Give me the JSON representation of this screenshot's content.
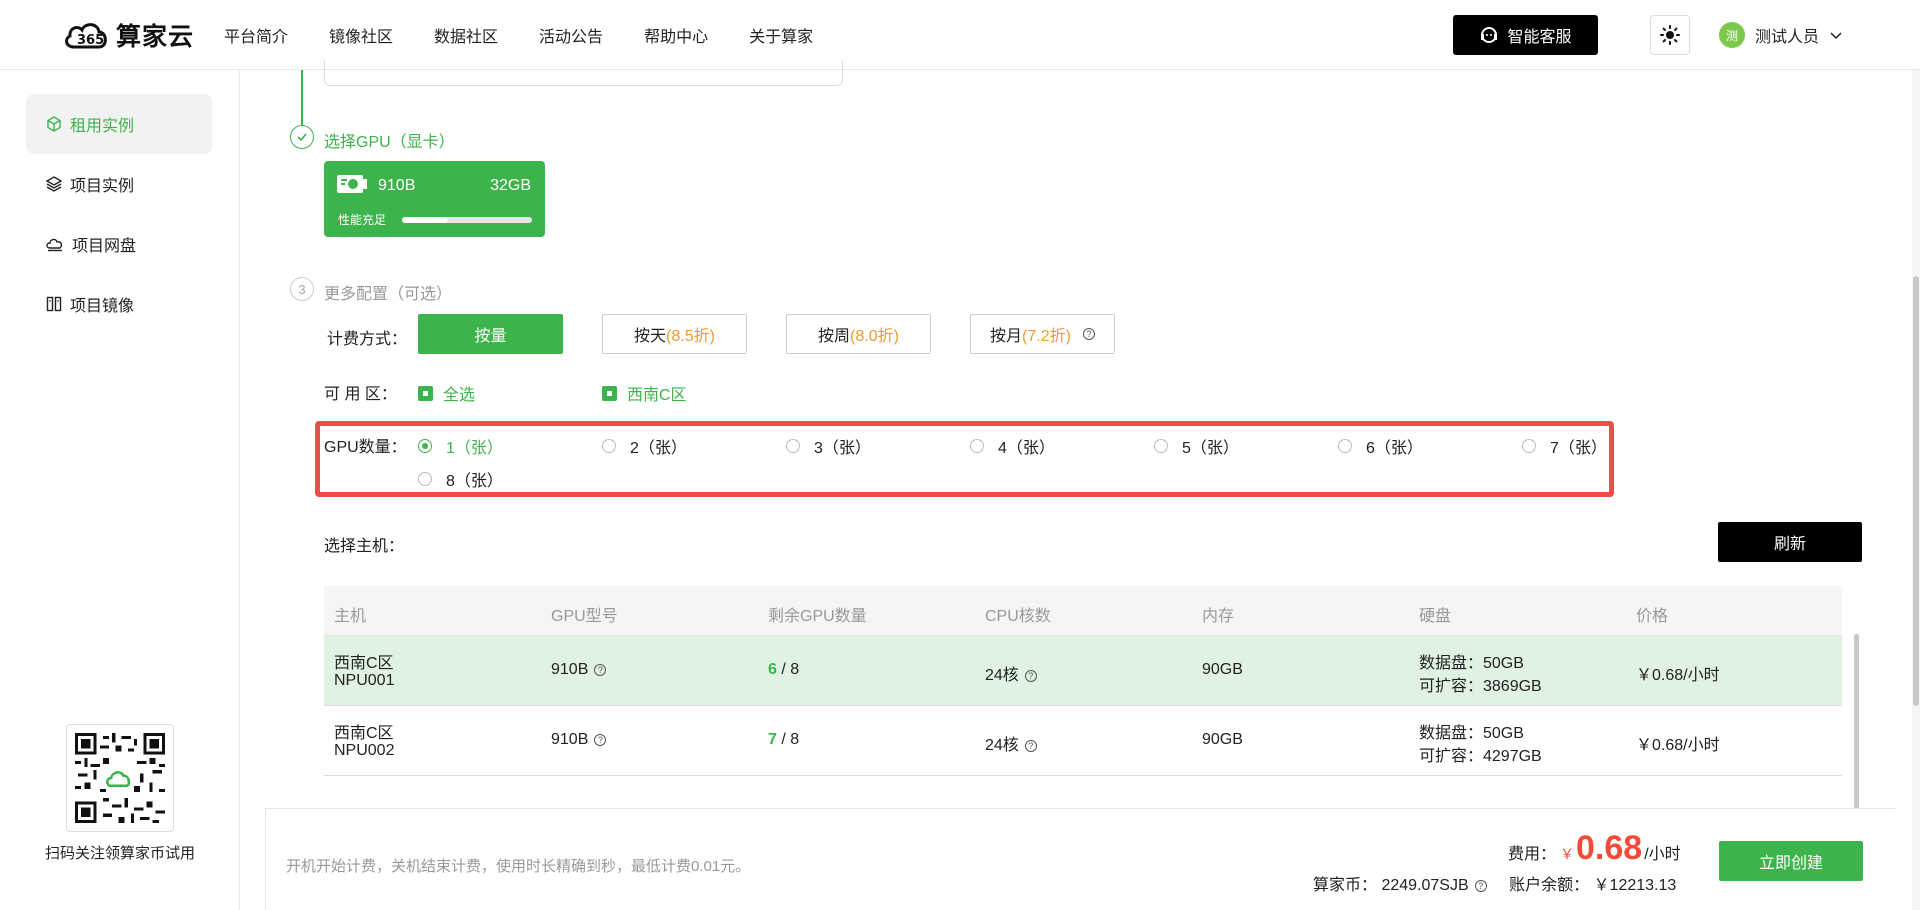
{
  "header": {
    "logo_text": "算家云",
    "nav": [
      "平台简介",
      "镜像社区",
      "数据社区",
      "活动公告",
      "帮助中心",
      "关于算家"
    ],
    "service_label": "智能客服",
    "user_avatar": "测",
    "user_name": "测试人员"
  },
  "sidebar": {
    "items": [
      {
        "label": "租用实例",
        "icon": "cube-icon",
        "active": true
      },
      {
        "label": "项目实例",
        "icon": "layers-icon",
        "active": false
      },
      {
        "label": "项目网盘",
        "icon": "cloud-disk-icon",
        "active": false
      },
      {
        "label": "项目镜像",
        "icon": "image-icon",
        "active": false
      }
    ],
    "qr_caption": "扫码关注领算家币试用"
  },
  "steps": {
    "gpu_title": "选择GPU（显卡）",
    "more_number": "3",
    "more_title": "更多配置（可选）"
  },
  "gpu_card": {
    "name": "910B",
    "memory": "32GB",
    "perf_label": "性能充足",
    "perf_level": 0.35
  },
  "billing": {
    "label": "计费方式：",
    "options": [
      {
        "label": "按量",
        "discount": ""
      },
      {
        "label": "按天",
        "discount": "(8.5折)"
      },
      {
        "label": "按周",
        "discount": "(8.0折)"
      },
      {
        "label": "按月",
        "discount": "(7.2折)"
      }
    ]
  },
  "zone": {
    "label": "可 用 区：",
    "select_all": "全选",
    "region": "西南C区"
  },
  "gpu_count": {
    "label": "GPU数量：",
    "options": [
      "1（张）",
      "2（张）",
      "3（张）",
      "4（张）",
      "5（张）",
      "6（张）",
      "7（张）",
      "8（张）"
    ],
    "selected": 0
  },
  "host": {
    "label": "选择主机：",
    "refresh": "刷新",
    "columns": [
      "主机",
      "GPU型号",
      "剩余GPU数量",
      "CPU核数",
      "内存",
      "硬盘",
      "价格"
    ],
    "rows": [
      {
        "region": "西南C区",
        "id": "NPU001",
        "gpu": "910B",
        "avail": "6",
        "total": "/ 8",
        "cpu": "24核",
        "mem": "90GB",
        "disk": "数据盘：50GB",
        "expand": "可扩容：3869GB",
        "price": "￥0.68/小时"
      },
      {
        "region": "西南C区",
        "id": "NPU002",
        "gpu": "910B",
        "avail": "7",
        "total": "/ 8",
        "cpu": "24核",
        "mem": "90GB",
        "disk": "数据盘：50GB",
        "expand": "可扩容：4297GB",
        "price": "￥0.68/小时"
      }
    ]
  },
  "footer": {
    "note": "开机开始计费，关机结束计费，使用时长精确到秒，最低计费0.01元。",
    "fee_label": "费用：",
    "currency": "￥",
    "amount": "0.68",
    "unit": "/小时",
    "coins": "算家币： 2249.07SJB",
    "balance": "账户余额： ￥12213.13",
    "create": "立即创建"
  },
  "colors": {
    "accent": "#3cb44b",
    "highlight": "#ef4b4b",
    "discount": "#f29a2e",
    "price": "#f24b3b"
  }
}
